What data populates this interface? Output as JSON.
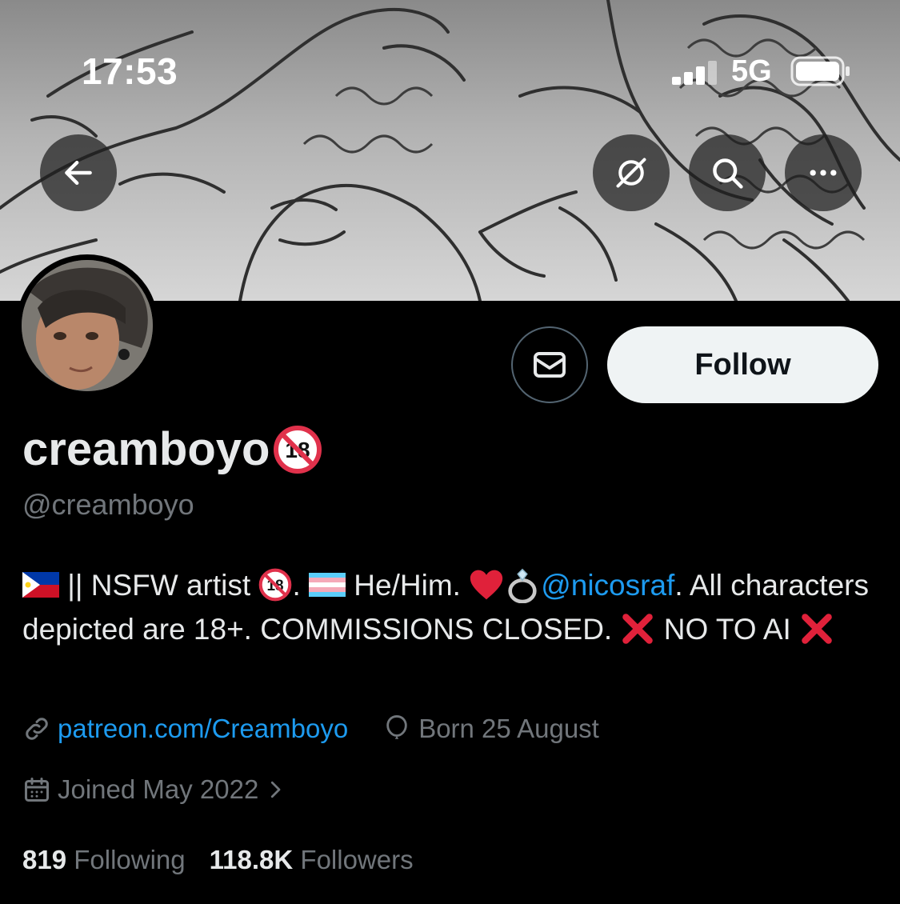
{
  "status_bar": {
    "time": "17:53",
    "network": "5G"
  },
  "banner": {
    "back_icon": "arrow-left-icon",
    "actions": [
      {
        "name": "grok-icon"
      },
      {
        "name": "search-icon"
      },
      {
        "name": "more-icon"
      }
    ]
  },
  "profile": {
    "display_name": "creamboyo",
    "handle": "@creamboyo",
    "follow_label": "Follow",
    "bio": {
      "part1": " || NSFW artist ",
      "part2": ". ",
      "part3": " He/Him. ",
      "mention": "@nicosraf",
      "part4": ". All characters depicted are 18+. COMMISSIONS CLOSED. ",
      "part5": " NO TO AI "
    },
    "website": "patreon.com/Creamboyo",
    "birthday": "Born 25 August",
    "joined": "Joined May 2022",
    "following_count": "819",
    "following_label": "Following",
    "followers_count": "118.8K",
    "followers_label": "Followers"
  },
  "colors": {
    "accent": "#1d9bf0",
    "muted": "#71767b",
    "text": "#e7e9ea",
    "background": "#000000"
  }
}
